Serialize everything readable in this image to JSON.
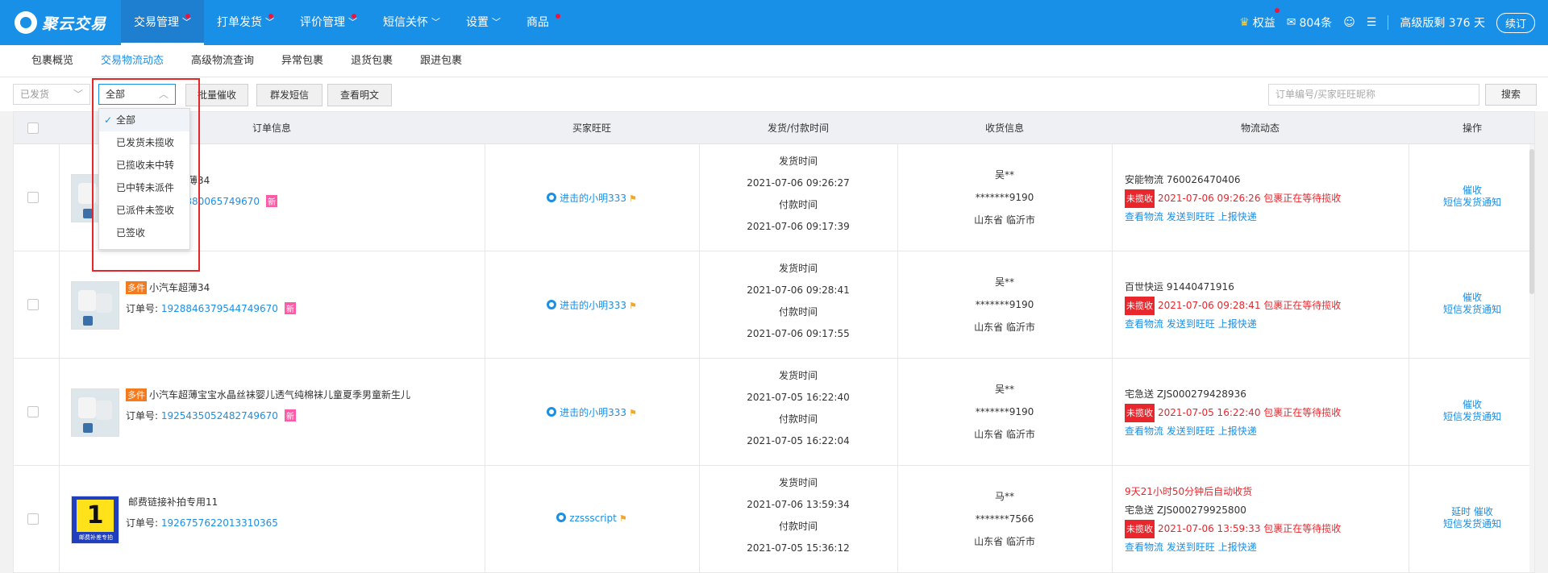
{
  "app": {
    "logo": "聚云交易"
  },
  "nav": [
    {
      "label": "交易管理",
      "chevron": true,
      "dot": true,
      "active": true
    },
    {
      "label": "打单发货",
      "chevron": true,
      "dot": true
    },
    {
      "label": "评价管理",
      "chevron": true,
      "dot": true
    },
    {
      "label": "短信关怀",
      "chevron": true,
      "dot": false
    },
    {
      "label": "设置",
      "chevron": true,
      "dot": false
    },
    {
      "label": "商品",
      "chevron": false,
      "dot": true
    }
  ],
  "top_right": {
    "rights": "权益",
    "sms_count": "804条",
    "version": "高级版剩 376 天",
    "renew": "续订"
  },
  "subtabs": [
    "包裹概览",
    "交易物流动态",
    "高级物流查询",
    "异常包裹",
    "退货包裹",
    "跟进包裹"
  ],
  "filters": {
    "status_select": "已发货",
    "logistics_select": "全部",
    "batch_remind": "批量催收",
    "group_sms": "群发短信",
    "view_plain": "查看明文",
    "search_placeholder": "订单编号/买家旺旺昵称",
    "search_button": "搜索"
  },
  "dropdown": {
    "options": [
      "全部",
      "已发货未揽收",
      "已揽收未中转",
      "已中转未派件",
      "已派件未签收",
      "已签收"
    ],
    "selected": "全部"
  },
  "columns": [
    "订单信息",
    "买家旺旺",
    "发货/付款时间",
    "收货信息",
    "物流动态",
    "操作"
  ],
  "labels": {
    "order_no": "订单号:",
    "ship_time": "发货时间",
    "pay_time": "付款时间",
    "view_logistics": "查看物流",
    "send_ww": "发送到旺旺",
    "report_express": "上报快递",
    "remind": "催收",
    "sms_notify": "短信发货通知",
    "delay": "延时",
    "multi_tag": "多件",
    "new_tag": "新",
    "not_collected": "未揽收"
  },
  "rows": [
    {
      "title": "小汽车超薄34",
      "multi": true,
      "order_no": "1928880065749670",
      "new": true,
      "buyer": "进击的小明333",
      "ship_time": "2021-07-06 09:26:27",
      "pay_time": "2021-07-06 09:17:39",
      "recv_name": "吴**",
      "recv_phone": "*******9190",
      "recv_addr": "山东省 临沂市",
      "carrier": "安能物流",
      "tracking": "760026470406",
      "status_text": "2021-07-06 09:26:26 包裹正在等待揽收",
      "auto_receive": "",
      "ops_delay": false
    },
    {
      "title": "小汽车超薄34",
      "multi": true,
      "order_no": "1928846379544749670",
      "new": true,
      "buyer": "进击的小明333",
      "ship_time": "2021-07-06 09:28:41",
      "pay_time": "2021-07-06 09:17:55",
      "recv_name": "吴**",
      "recv_phone": "*******9190",
      "recv_addr": "山东省 临沂市",
      "carrier": "百世快运",
      "tracking": "91440471916",
      "status_text": "2021-07-06 09:28:41 包裹正在等待揽收",
      "auto_receive": "",
      "ops_delay": false
    },
    {
      "title": "小汽车超薄宝宝水晶丝袜婴儿透气纯棉袜儿童夏季男童新生儿",
      "multi": true,
      "order_no": "1925435052482749670",
      "new": true,
      "buyer": "进击的小明333",
      "ship_time": "2021-07-05 16:22:40",
      "pay_time": "2021-07-05 16:22:04",
      "recv_name": "吴**",
      "recv_phone": "*******9190",
      "recv_addr": "山东省 临沂市",
      "carrier": "宅急送",
      "tracking": "ZJS000279428936",
      "status_text": "2021-07-05 16:22:40 包裹正在等待揽收",
      "auto_receive": "",
      "ops_delay": false
    },
    {
      "title": "邮费链接补拍专用11",
      "multi": false,
      "order_no": "1926757622013310365",
      "new": false,
      "buyer": "zzssscript",
      "ship_time": "2021-07-06 13:59:34",
      "pay_time": "2021-07-05 15:36:12",
      "recv_name": "马**",
      "recv_phone": "*******7566",
      "recv_addr": "山东省 临沂市",
      "carrier": "宅急送",
      "tracking": "ZJS000279925800",
      "status_text": "2021-07-06 13:59:33 包裹正在等待揽收",
      "auto_receive": "9天21小时50分钟后自动收货",
      "ops_delay": true,
      "promo_big": "1",
      "promo_small": "邮费补差专拍"
    }
  ],
  "colors": {
    "brand": "#1890e8",
    "link": "#1a8fe6",
    "alert": "#e8262c",
    "tag_orange": "#f47a1e",
    "tag_pink": "#ff5aa8"
  }
}
